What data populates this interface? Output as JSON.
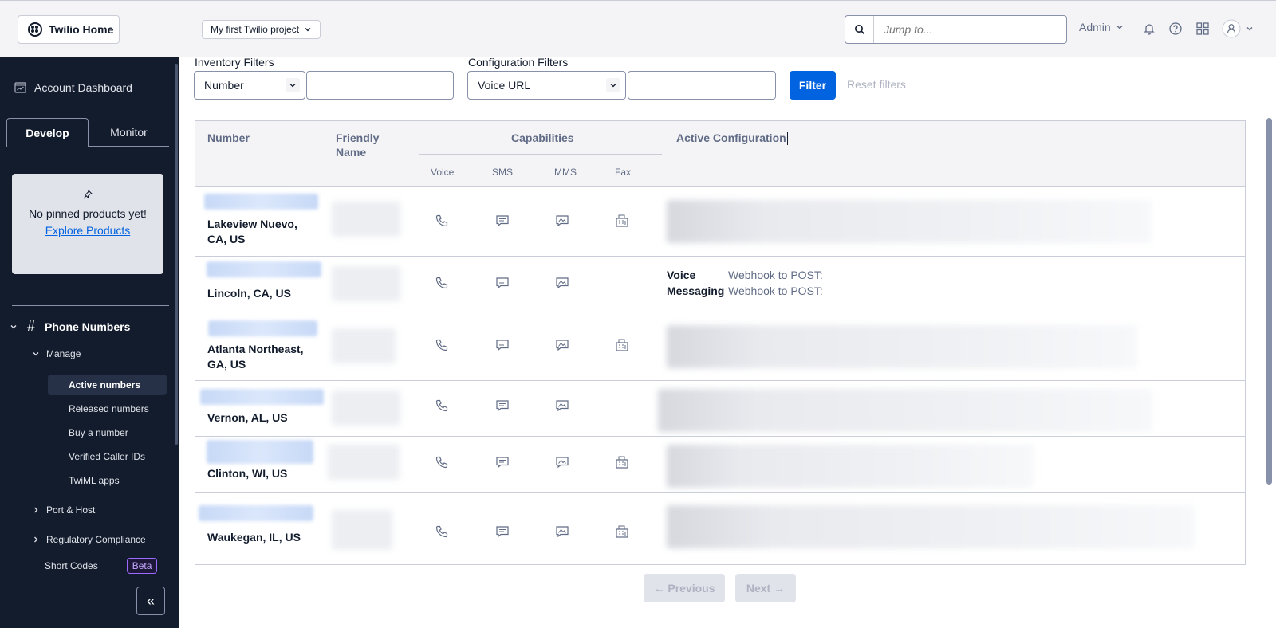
{
  "topbar": {
    "home_label": "Twilio Home",
    "project_label": "My first Twilio project",
    "search_placeholder": "Jump to...",
    "account_label": "Admin"
  },
  "sidebar": {
    "dashboard_label": "Account Dashboard",
    "tabs": [
      {
        "label": "Develop"
      },
      {
        "label": "Monitor"
      }
    ],
    "pinned": {
      "message": "No pinned products yet!",
      "link": "Explore Products"
    },
    "section": "Phone Numbers",
    "manage": "Manage",
    "items": [
      {
        "label": "Active numbers"
      },
      {
        "label": "Released numbers"
      },
      {
        "label": "Buy a number"
      },
      {
        "label": "Verified Caller IDs"
      },
      {
        "label": "TwiML apps"
      }
    ],
    "port_host": "Port & Host",
    "regulatory": "Regulatory Compliance",
    "short_codes": "Short Codes",
    "beta": "Beta"
  },
  "filters": {
    "inventory_label": "Inventory Filters",
    "inventory_select": "Number",
    "config_label": "Configuration Filters",
    "config_select": "Voice URL",
    "filter_button": "Filter",
    "reset_button": "Reset filters"
  },
  "table": {
    "headers": {
      "number": "Number",
      "friendly_name": "Friendly Name",
      "capabilities": "Capabilities",
      "voice": "Voice",
      "sms": "SMS",
      "mms": "MMS",
      "fax": "Fax",
      "active_config": "Active Configuration"
    },
    "rows": [
      {
        "location": "Lakeview Nuevo, CA, US",
        "voice": true,
        "sms": true,
        "mms": true,
        "fax": true
      },
      {
        "location": "Lincoln, CA, US",
        "voice": true,
        "sms": true,
        "mms": true,
        "fax": false,
        "config": [
          {
            "label": "Voice",
            "value": "Webhook to POST:"
          },
          {
            "label": "Messaging",
            "value": "Webhook to POST:"
          }
        ]
      },
      {
        "location": "Atlanta Northeast, GA, US",
        "voice": true,
        "sms": true,
        "mms": true,
        "fax": true
      },
      {
        "location": "Vernon, AL, US",
        "voice": true,
        "sms": true,
        "mms": true,
        "fax": false
      },
      {
        "location": "Clinton, WI, US",
        "voice": true,
        "sms": true,
        "mms": true,
        "fax": true
      },
      {
        "location": "Waukegan, IL, US",
        "voice": true,
        "sms": true,
        "mms": true,
        "fax": true
      }
    ]
  },
  "pagination": {
    "previous": "← Previous",
    "next": "Next →"
  }
}
